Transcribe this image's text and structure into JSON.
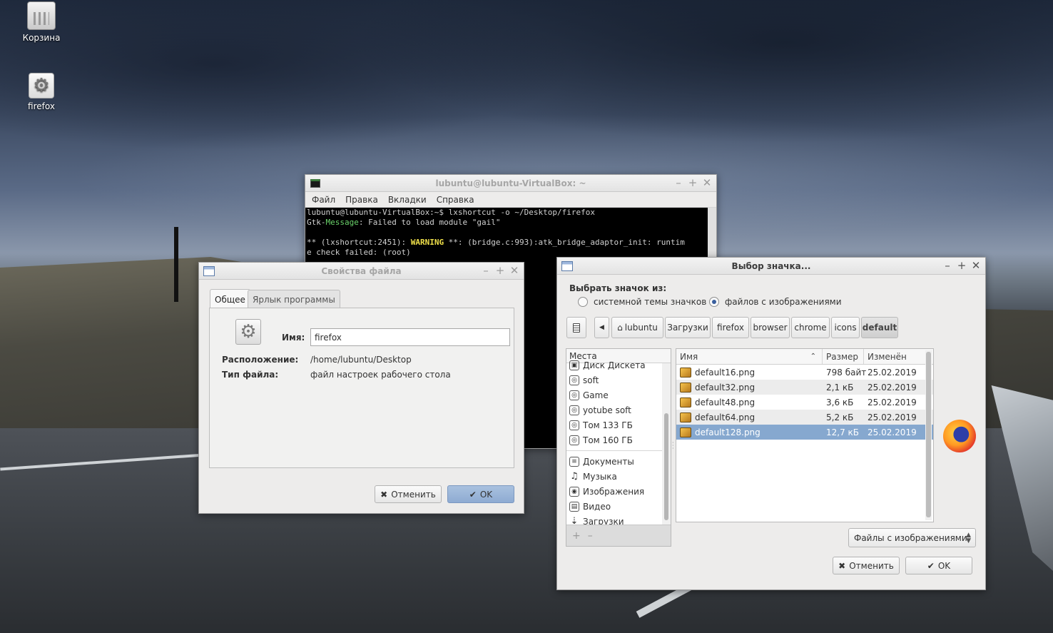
{
  "desktop": {
    "icons": [
      {
        "label": "Корзина",
        "icon": "trash-icon"
      },
      {
        "label": "firefox",
        "icon": "gear-icon"
      }
    ]
  },
  "terminal": {
    "title": "lubuntu@lubuntu-VirtualBox: ~",
    "menu": [
      "Файл",
      "Правка",
      "Вкладки",
      "Справка"
    ],
    "lines": {
      "l1": "lubuntu@lubuntu-VirtualBox:~$ lxshortcut -o ~/Desktop/firefox",
      "l2a": "Gtk-",
      "l2b": "Message",
      "l2c": ": Failed to load module \"gail\"",
      "l3a": "** (lxshortcut:2451): ",
      "l3b": "WARNING",
      "l3c": " **: (bridge.c:993):atk_bridge_adaptor_init: runtim",
      "l4": "e check failed: (root)"
    }
  },
  "file_props": {
    "title": "Свойства файла",
    "tabs": [
      "Общее",
      "Ярлык программы"
    ],
    "name_label": "Имя:",
    "name_value": "firefox",
    "location_label": "Расположение:",
    "location_value": "/home/lubuntu/Desktop",
    "type_label": "Тип файла:",
    "type_value": "файл настроек рабочего стола",
    "cancel_label": "Отменить",
    "ok_label": "OK"
  },
  "icon_chooser": {
    "title": "Выбор значка...",
    "choose_from_label": "Выбрать значок из:",
    "radio_theme": "системной темы значков",
    "radio_files": "файлов с изображениями",
    "selected_radio": "files",
    "breadcrumbs": [
      "lubuntu",
      "Загрузки",
      "firefox",
      "browser",
      "chrome",
      "icons",
      "default"
    ],
    "places_header": "Места",
    "places": [
      "Диск Дискета",
      "soft",
      "Game",
      "yotube soft",
      "Том 133 ГБ",
      "Том 160 ГБ"
    ],
    "bookmarks": [
      "Документы",
      "Музыка",
      "Изображения",
      "Видео",
      "Загрузки"
    ],
    "columns": {
      "name": "Имя",
      "size": "Размер",
      "modified": "Изменён"
    },
    "files": [
      {
        "name": "default16.png",
        "size": "798 байт",
        "modified": "25.02.2019"
      },
      {
        "name": "default32.png",
        "size": "2,1 кБ",
        "modified": "25.02.2019"
      },
      {
        "name": "default48.png",
        "size": "3,6 кБ",
        "modified": "25.02.2019"
      },
      {
        "name": "default64.png",
        "size": "5,2 кБ",
        "modified": "25.02.2019"
      },
      {
        "name": "default128.png",
        "size": "12,7 кБ",
        "modified": "25.02.2019"
      }
    ],
    "selected_file": "default128.png",
    "filter": "Файлы с изображениями",
    "cancel_label": "Отменить",
    "ok_label": "OK"
  },
  "colors": {
    "selection": "#86a8cf",
    "ok_button": "#9bb6da"
  }
}
